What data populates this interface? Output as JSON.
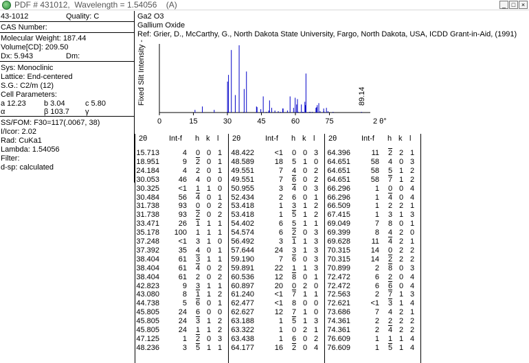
{
  "window": {
    "title": "PDF # 431012,  Wavelength = 1.54056    (A)",
    "buttons": [
      "_",
      "□",
      "×"
    ]
  },
  "card": {
    "pdf_number": "43-1012",
    "quality": "Quality: C",
    "cas": "CAS Number:",
    "mol_weight": "Molecular Weight:  187.44",
    "volume": "Volume[CD]:   209.50",
    "dx": "Dx:  5.943",
    "dm": "Dm:",
    "sys": "Sys: Monoclinic",
    "lattice": "Lattice: End-centered",
    "sg": "S.G.: C2/m (12)",
    "cell_params": "Cell Parameters:",
    "a": "a  12.23",
    "b": "b  3.04",
    "c": "c  5.80",
    "alpha": "α",
    "beta": "β  103.7",
    "gamma": "γ",
    "ssfom": "SS/FOM: F30=117(.0067, 38)",
    "icor": "I/Icor: 2.02",
    "rad": "Rad: CuKa1",
    "lambda": "Lambda: 1.54056",
    "filter": "Filter:",
    "dsp": "d-sp: calculated",
    "formula": "Ga2 O3",
    "name": "Gallium Oxide",
    "ref": "Ref: Grier, D., McCarthy, G., North Dakota State University, Fargo, North Dakota, USA, ICDD Grant-in-Aid, (1991)"
  },
  "chart_data": {
    "type": "bar",
    "ylabel": "Fixed  Slit  Intensity  ->",
    "xlabel": "2 θ°",
    "x_ticks": [
      "0",
      "15",
      "30",
      "45",
      "60",
      "75"
    ],
    "xlim": [
      0,
      90
    ],
    "ylim": [
      0,
      100
    ],
    "annotation": "89.14",
    "peaks": [
      {
        "x": 15.713,
        "y": 4
      },
      {
        "x": 18.951,
        "y": 9
      },
      {
        "x": 24.184,
        "y": 4
      },
      {
        "x": 30.053,
        "y": 46
      },
      {
        "x": 30.325,
        "y": 1
      },
      {
        "x": 30.484,
        "y": 56
      },
      {
        "x": 31.738,
        "y": 93
      },
      {
        "x": 33.471,
        "y": 26
      },
      {
        "x": 35.178,
        "y": 100
      },
      {
        "x": 37.248,
        "y": 1
      },
      {
        "x": 37.392,
        "y": 35
      },
      {
        "x": 38.404,
        "y": 61
      },
      {
        "x": 42.823,
        "y": 9
      },
      {
        "x": 43.08,
        "y": 8
      },
      {
        "x": 44.738,
        "y": 5
      },
      {
        "x": 45.805,
        "y": 24
      },
      {
        "x": 47.125,
        "y": 1
      },
      {
        "x": 48.236,
        "y": 3
      },
      {
        "x": 48.422,
        "y": 1
      },
      {
        "x": 48.589,
        "y": 18
      },
      {
        "x": 49.551,
        "y": 7
      },
      {
        "x": 50.955,
        "y": 3
      },
      {
        "x": 52.434,
        "y": 2
      },
      {
        "x": 53.418,
        "y": 1
      },
      {
        "x": 54.402,
        "y": 6
      },
      {
        "x": 54.574,
        "y": 6
      },
      {
        "x": 56.492,
        "y": 3
      },
      {
        "x": 57.644,
        "y": 24
      },
      {
        "x": 59.19,
        "y": 7
      },
      {
        "x": 59.891,
        "y": 22
      },
      {
        "x": 60.536,
        "y": 12
      },
      {
        "x": 60.897,
        "y": 20
      },
      {
        "x": 61.24,
        "y": 1
      },
      {
        "x": 62.477,
        "y": 1
      },
      {
        "x": 62.627,
        "y": 12
      },
      {
        "x": 63.188,
        "y": 1
      },
      {
        "x": 63.322,
        "y": 1
      },
      {
        "x": 63.438,
        "y": 1
      },
      {
        "x": 64.177,
        "y": 16
      },
      {
        "x": 64.396,
        "y": 11
      },
      {
        "x": 64.651,
        "y": 58
      },
      {
        "x": 66.296,
        "y": 1
      },
      {
        "x": 66.509,
        "y": 1
      },
      {
        "x": 67.415,
        "y": 1
      },
      {
        "x": 69.049,
        "y": 7
      },
      {
        "x": 69.399,
        "y": 8
      },
      {
        "x": 69.628,
        "y": 11
      },
      {
        "x": 70.315,
        "y": 14
      },
      {
        "x": 70.899,
        "y": 2
      },
      {
        "x": 72.472,
        "y": 6
      },
      {
        "x": 72.563,
        "y": 2
      },
      {
        "x": 72.621,
        "y": 1
      },
      {
        "x": 73.686,
        "y": 7
      },
      {
        "x": 74.361,
        "y": 2
      },
      {
        "x": 76.609,
        "y": 1
      },
      {
        "x": 89.14,
        "y": 1
      }
    ]
  },
  "table": {
    "headers": [
      "2θ",
      "Int-f",
      "h",
      "k",
      "l"
    ],
    "columns": [
      [
        [
          "15.713",
          "4",
          "0",
          "0",
          "1"
        ],
        [
          "18.951",
          "9",
          "-2",
          "0",
          "1"
        ],
        [
          "24.184",
          "4",
          "2",
          "0",
          "1"
        ],
        [
          "30.053",
          "46",
          "4",
          "0",
          "0"
        ],
        [
          "30.325",
          "<1",
          "1",
          "1",
          "0"
        ],
        [
          "30.484",
          "56",
          "-4",
          "0",
          "1"
        ],
        [
          "31.738",
          "93",
          "0",
          "0",
          "2"
        ],
        [
          "31.738",
          "93",
          "-2",
          "0",
          "2"
        ],
        [
          "33.471",
          "26",
          "-1",
          "1",
          "1"
        ],
        [
          "35.178",
          "100",
          "1",
          "1",
          "1"
        ],
        [
          "37.248",
          "<1",
          "3",
          "1",
          "0"
        ],
        [
          "37.392",
          "35",
          "4",
          "0",
          "1"
        ],
        [
          "38.404",
          "61",
          "-3",
          "1",
          "1"
        ],
        [
          "38.404",
          "61",
          "-4",
          "0",
          "2"
        ],
        [
          "38.404",
          "61",
          "2",
          "0",
          "2"
        ],
        [
          "42.823",
          "9",
          "3",
          "1",
          "1"
        ],
        [
          "43.080",
          "8",
          "-1",
          "1",
          "2"
        ],
        [
          "44.738",
          "5",
          "-6",
          "0",
          "1"
        ],
        [
          "45.805",
          "24",
          "6",
          "0",
          "0"
        ],
        [
          "45.805",
          "24",
          "-3",
          "1",
          "2"
        ],
        [
          "45.805",
          "24",
          "1",
          "1",
          "2"
        ],
        [
          "47.125",
          "1",
          "-2",
          "0",
          "3"
        ],
        [
          "48.236",
          "3",
          "-5",
          "1",
          "1"
        ]
      ],
      [
        [
          "48.422",
          "<1",
          "0",
          "0",
          "3"
        ],
        [
          "48.589",
          "18",
          "5",
          "1",
          "0"
        ],
        [
          "49.551",
          "7",
          "4",
          "0",
          "2"
        ],
        [
          "49.551",
          "7",
          "-6",
          "0",
          "2"
        ],
        [
          "50.955",
          "3",
          "-4",
          "0",
          "3"
        ],
        [
          "52.434",
          "2",
          "6",
          "0",
          "1"
        ],
        [
          "53.418",
          "1",
          "3",
          "1",
          "2"
        ],
        [
          "53.418",
          "1",
          "-5",
          "1",
          "2"
        ],
        [
          "54.402",
          "6",
          "5",
          "1",
          "1"
        ],
        [
          "54.574",
          "6",
          "-2",
          "0",
          "3"
        ],
        [
          "56.492",
          "3",
          "-1",
          "1",
          "3"
        ],
        [
          "57.644",
          "24",
          "3",
          "1",
          "3"
        ],
        [
          "59.190",
          "7",
          "-6",
          "0",
          "3"
        ],
        [
          "59.891",
          "22",
          "1",
          "1",
          "3"
        ],
        [
          "60.536",
          "12",
          "-8",
          "0",
          "1"
        ],
        [
          "60.897",
          "20",
          "0",
          "2",
          "0"
        ],
        [
          "61.240",
          "<1",
          "-7",
          "1",
          "1"
        ],
        [
          "62.477",
          "<1",
          "8",
          "0",
          "0"
        ],
        [
          "62.627",
          "12",
          "7",
          "1",
          "0"
        ],
        [
          "63.188",
          "1",
          "-5",
          "1",
          "3"
        ],
        [
          "63.322",
          "1",
          "0",
          "2",
          "1"
        ],
        [
          "63.438",
          "1",
          "6",
          "0",
          "2"
        ],
        [
          "64.177",
          "16",
          "-2",
          "0",
          "4"
        ]
      ],
      [
        [
          "64.396",
          "11",
          "-2",
          "2",
          "1"
        ],
        [
          "64.651",
          "58",
          "4",
          "0",
          "3"
        ],
        [
          "64.651",
          "58",
          "5",
          "1",
          "2"
        ],
        [
          "64.651",
          "58",
          "-7",
          "1",
          "2"
        ],
        [
          "66.296",
          "1",
          "0",
          "0",
          "4"
        ],
        [
          "66.296",
          "1",
          "-4",
          "0",
          "4"
        ],
        [
          "66.509",
          "1",
          "2",
          "2",
          "1"
        ],
        [
          "67.415",
          "1",
          "3",
          "1",
          "3"
        ],
        [
          "69.049",
          "7",
          "8",
          "0",
          "1"
        ],
        [
          "69.399",
          "8",
          "4",
          "2",
          "0"
        ],
        [
          "69.628",
          "11",
          "-4",
          "2",
          "1"
        ],
        [
          "70.315",
          "14",
          "0",
          "2",
          "2"
        ],
        [
          "70.315",
          "14",
          "-2",
          "2",
          "2"
        ],
        [
          "70.899",
          "2",
          "-8",
          "0",
          "3"
        ],
        [
          "72.472",
          "6",
          "2",
          "0",
          "4"
        ],
        [
          "72.472",
          "6",
          "-6",
          "0",
          "4"
        ],
        [
          "72.563",
          "2",
          "-7",
          "1",
          "3"
        ],
        [
          "72.621",
          "<1",
          "-3",
          "1",
          "4"
        ],
        [
          "73.686",
          "7",
          "4",
          "2",
          "1"
        ],
        [
          "74.361",
          "2",
          "2",
          "2",
          "2"
        ],
        [
          "74.361",
          "2",
          "-4",
          "2",
          "2"
        ],
        [
          "76.609",
          "1",
          "1",
          "1",
          "4"
        ],
        [
          "76.609",
          "1",
          "-5",
          "1",
          "4"
        ]
      ]
    ]
  }
}
